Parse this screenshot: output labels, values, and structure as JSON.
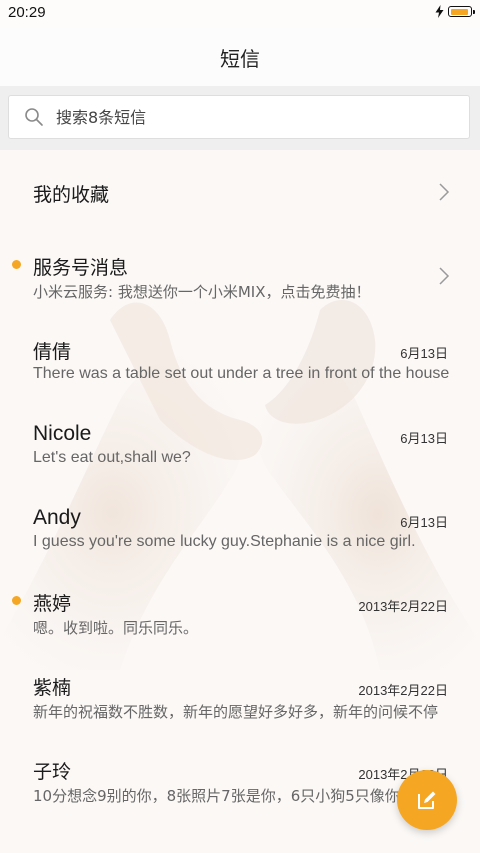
{
  "status_bar": {
    "time": "20:29",
    "charging_icon": "lightning-icon",
    "battery_level": 0.9,
    "battery_color": "#f5a623"
  },
  "header": {
    "title": "短信"
  },
  "search": {
    "placeholder": "搜索8条短信",
    "icon": "search-icon"
  },
  "favorites": {
    "label": "我的收藏"
  },
  "conversations": [
    {
      "name": "服务号消息",
      "preview": "小米云服务: 我想送你一个小米MIX，点击免费抽！",
      "date": "",
      "unread": true,
      "has_chevron": true
    },
    {
      "name": "倩倩",
      "preview": "There was a table set out under a tree in front of the house",
      "date": "6月13日",
      "unread": false,
      "has_chevron": false
    },
    {
      "name": "Nicole",
      "preview": "Let's eat out,shall we?",
      "date": "6月13日",
      "unread": false,
      "has_chevron": false
    },
    {
      "name": "Andy",
      "preview": "I guess you're some lucky guy.Stephanie is a nice girl.",
      "date": "6月13日",
      "unread": false,
      "has_chevron": false
    },
    {
      "name": "燕婷",
      "preview": "嗯。收到啦。同乐同乐。",
      "date": "2013年2月22日",
      "unread": true,
      "has_chevron": false
    },
    {
      "name": "紫楠",
      "preview": "新年的祝福数不胜数，新年的愿望好多好多，新年的问候不停",
      "date": "2013年2月22日",
      "unread": false,
      "has_chevron": false
    },
    {
      "name": "子玲",
      "preview": "10分想念9别的你，8张照片7张是你，6只小狗5只像你",
      "date": "2013年2月22日",
      "unread": false,
      "has_chevron": false
    }
  ],
  "fab": {
    "icon": "compose-icon"
  },
  "colors": {
    "accent": "#f5a623",
    "search_bg": "#efefef",
    "text_primary": "#1a1a1a",
    "text_secondary": "#666666"
  }
}
